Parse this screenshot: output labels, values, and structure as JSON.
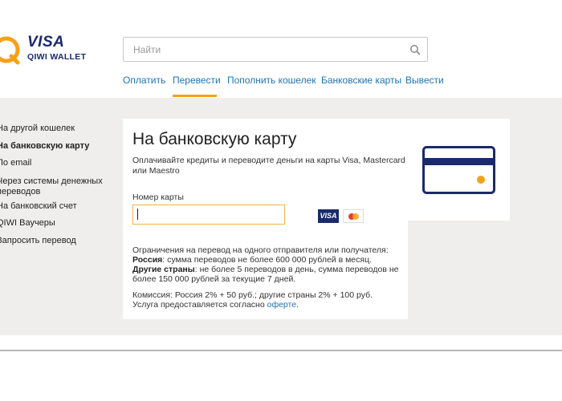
{
  "brand": {
    "visa": "VISA",
    "qiwi": "QIWI WALLET",
    "colors": {
      "navy": "#1a2a6c",
      "orange": "#f6a01a",
      "link": "#1d74b3"
    }
  },
  "search": {
    "placeholder": "Найти",
    "value": "",
    "icon": "search-icon"
  },
  "nav": {
    "items": [
      {
        "label": "Оплатить"
      },
      {
        "label": "Перевести",
        "active": true
      },
      {
        "label": "Пополнить кошелек"
      },
      {
        "label": "Банковские карты"
      },
      {
        "label": "Вывести"
      }
    ]
  },
  "sidebar": {
    "items": [
      {
        "label": "На другой кошелек"
      },
      {
        "label": "На банковскую карту",
        "active": true
      },
      {
        "label": "По email"
      },
      {
        "label": "Через системы денежных",
        "label2": "переводов"
      },
      {
        "label": "На банковский счет"
      },
      {
        "label": "QIWI Ваучеры"
      },
      {
        "label": "Запросить перевод"
      }
    ]
  },
  "main": {
    "title": "На банковскую карту",
    "description": "Оплачивайте кредиты и переводите деньги на карты Visa, Mastercard или Maestro",
    "card_field": {
      "label": "Номер карты",
      "value": "",
      "placeholder": ""
    },
    "badges": {
      "visa": "VISA"
    },
    "limits": {
      "intro": "Ограничения на перевод на одного отправителя или получателя:",
      "russia_label": "Россия",
      "russia_text": ": сумма переводов не более 600 000 рублей в месяц.",
      "other_label": "Другие страны",
      "other_text": ": не более 5 переводов в день, сумма переводов не более 150 000 рублей за текущие 7 дней."
    },
    "commission": {
      "text": "Комиссия: Россия 2% + 50 руб.; другие страны 2% + 100 руб.",
      "service_text": "Услуга предоставляется согласно ",
      "offer_link": "оферте",
      "offer_suffix": "."
    }
  }
}
